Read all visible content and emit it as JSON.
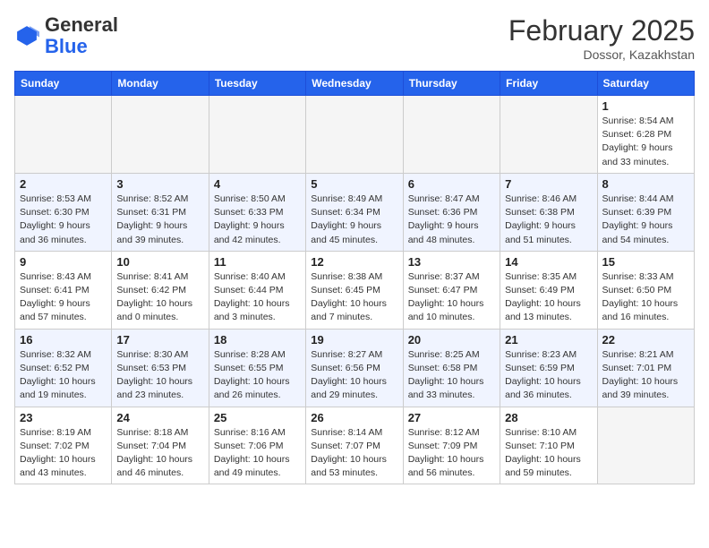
{
  "header": {
    "logo_general": "General",
    "logo_blue": "Blue",
    "month_title": "February 2025",
    "location": "Dossor, Kazakhstan"
  },
  "weekdays": [
    "Sunday",
    "Monday",
    "Tuesday",
    "Wednesday",
    "Thursday",
    "Friday",
    "Saturday"
  ],
  "weeks": [
    [
      {
        "day": "",
        "info": ""
      },
      {
        "day": "",
        "info": ""
      },
      {
        "day": "",
        "info": ""
      },
      {
        "day": "",
        "info": ""
      },
      {
        "day": "",
        "info": ""
      },
      {
        "day": "",
        "info": ""
      },
      {
        "day": "1",
        "info": "Sunrise: 8:54 AM\nSunset: 6:28 PM\nDaylight: 9 hours and 33 minutes."
      }
    ],
    [
      {
        "day": "2",
        "info": "Sunrise: 8:53 AM\nSunset: 6:30 PM\nDaylight: 9 hours and 36 minutes."
      },
      {
        "day": "3",
        "info": "Sunrise: 8:52 AM\nSunset: 6:31 PM\nDaylight: 9 hours and 39 minutes."
      },
      {
        "day": "4",
        "info": "Sunrise: 8:50 AM\nSunset: 6:33 PM\nDaylight: 9 hours and 42 minutes."
      },
      {
        "day": "5",
        "info": "Sunrise: 8:49 AM\nSunset: 6:34 PM\nDaylight: 9 hours and 45 minutes."
      },
      {
        "day": "6",
        "info": "Sunrise: 8:47 AM\nSunset: 6:36 PM\nDaylight: 9 hours and 48 minutes."
      },
      {
        "day": "7",
        "info": "Sunrise: 8:46 AM\nSunset: 6:38 PM\nDaylight: 9 hours and 51 minutes."
      },
      {
        "day": "8",
        "info": "Sunrise: 8:44 AM\nSunset: 6:39 PM\nDaylight: 9 hours and 54 minutes."
      }
    ],
    [
      {
        "day": "9",
        "info": "Sunrise: 8:43 AM\nSunset: 6:41 PM\nDaylight: 9 hours and 57 minutes."
      },
      {
        "day": "10",
        "info": "Sunrise: 8:41 AM\nSunset: 6:42 PM\nDaylight: 10 hours and 0 minutes."
      },
      {
        "day": "11",
        "info": "Sunrise: 8:40 AM\nSunset: 6:44 PM\nDaylight: 10 hours and 3 minutes."
      },
      {
        "day": "12",
        "info": "Sunrise: 8:38 AM\nSunset: 6:45 PM\nDaylight: 10 hours and 7 minutes."
      },
      {
        "day": "13",
        "info": "Sunrise: 8:37 AM\nSunset: 6:47 PM\nDaylight: 10 hours and 10 minutes."
      },
      {
        "day": "14",
        "info": "Sunrise: 8:35 AM\nSunset: 6:49 PM\nDaylight: 10 hours and 13 minutes."
      },
      {
        "day": "15",
        "info": "Sunrise: 8:33 AM\nSunset: 6:50 PM\nDaylight: 10 hours and 16 minutes."
      }
    ],
    [
      {
        "day": "16",
        "info": "Sunrise: 8:32 AM\nSunset: 6:52 PM\nDaylight: 10 hours and 19 minutes."
      },
      {
        "day": "17",
        "info": "Sunrise: 8:30 AM\nSunset: 6:53 PM\nDaylight: 10 hours and 23 minutes."
      },
      {
        "day": "18",
        "info": "Sunrise: 8:28 AM\nSunset: 6:55 PM\nDaylight: 10 hours and 26 minutes."
      },
      {
        "day": "19",
        "info": "Sunrise: 8:27 AM\nSunset: 6:56 PM\nDaylight: 10 hours and 29 minutes."
      },
      {
        "day": "20",
        "info": "Sunrise: 8:25 AM\nSunset: 6:58 PM\nDaylight: 10 hours and 33 minutes."
      },
      {
        "day": "21",
        "info": "Sunrise: 8:23 AM\nSunset: 6:59 PM\nDaylight: 10 hours and 36 minutes."
      },
      {
        "day": "22",
        "info": "Sunrise: 8:21 AM\nSunset: 7:01 PM\nDaylight: 10 hours and 39 minutes."
      }
    ],
    [
      {
        "day": "23",
        "info": "Sunrise: 8:19 AM\nSunset: 7:02 PM\nDaylight: 10 hours and 43 minutes."
      },
      {
        "day": "24",
        "info": "Sunrise: 8:18 AM\nSunset: 7:04 PM\nDaylight: 10 hours and 46 minutes."
      },
      {
        "day": "25",
        "info": "Sunrise: 8:16 AM\nSunset: 7:06 PM\nDaylight: 10 hours and 49 minutes."
      },
      {
        "day": "26",
        "info": "Sunrise: 8:14 AM\nSunset: 7:07 PM\nDaylight: 10 hours and 53 minutes."
      },
      {
        "day": "27",
        "info": "Sunrise: 8:12 AM\nSunset: 7:09 PM\nDaylight: 10 hours and 56 minutes."
      },
      {
        "day": "28",
        "info": "Sunrise: 8:10 AM\nSunset: 7:10 PM\nDaylight: 10 hours and 59 minutes."
      },
      {
        "day": "",
        "info": ""
      }
    ]
  ]
}
